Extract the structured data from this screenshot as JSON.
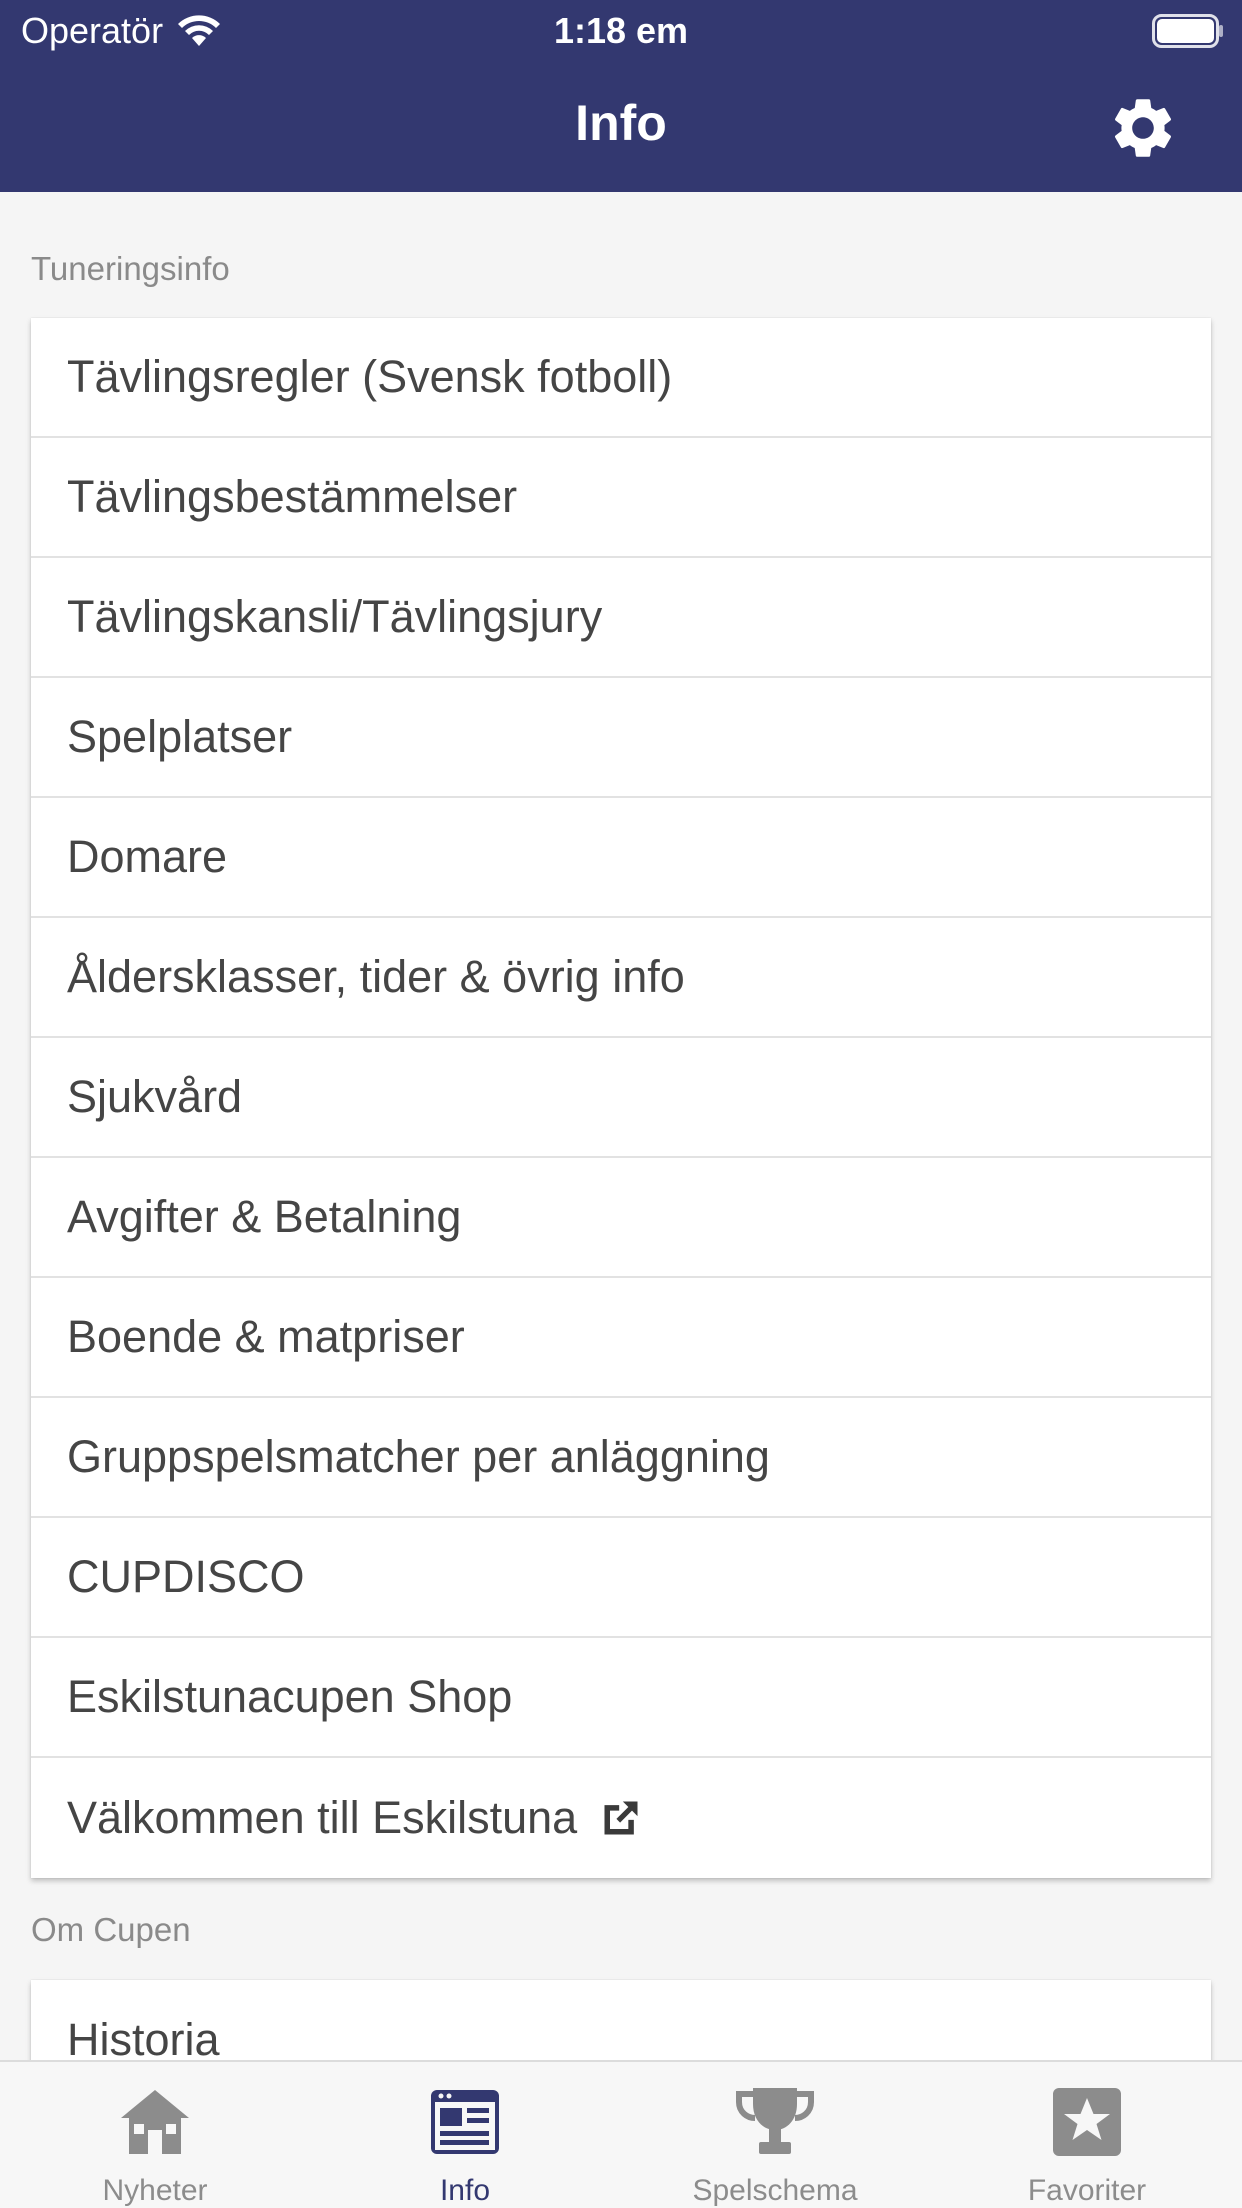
{
  "status_bar": {
    "carrier": "Operatör",
    "time": "1:18 em"
  },
  "header": {
    "title": "Info"
  },
  "sections": [
    {
      "label": "Tuneringsinfo",
      "items": [
        "Tävlingsregler (Svensk fotboll)",
        "Tävlingsbestämmelser",
        "Tävlingskansli/Tävlingsjury",
        "Spelplatser",
        "Domare",
        "Åldersklasser, tider & övrig info",
        "Sjukvård",
        "Avgifter & Betalning",
        "Boende & matpriser",
        "Gruppspelsmatcher per anläggning",
        "CUPDISCO",
        "Eskilstunacupen Shop",
        "Välkommen till Eskilstuna"
      ]
    },
    {
      "label": "Om Cupen",
      "items": [
        "Historia"
      ]
    }
  ],
  "tabs": [
    {
      "label": "Nyheter",
      "icon": "home-icon",
      "active": false
    },
    {
      "label": "Info",
      "icon": "info-icon",
      "active": true
    },
    {
      "label": "Spelschema",
      "icon": "trophy-icon",
      "active": false
    },
    {
      "label": "Favoriter",
      "icon": "star-icon",
      "active": false
    }
  ],
  "colors": {
    "header": "#333870",
    "active_tab": "#333870",
    "inactive_tab": "#8c8c8c"
  }
}
